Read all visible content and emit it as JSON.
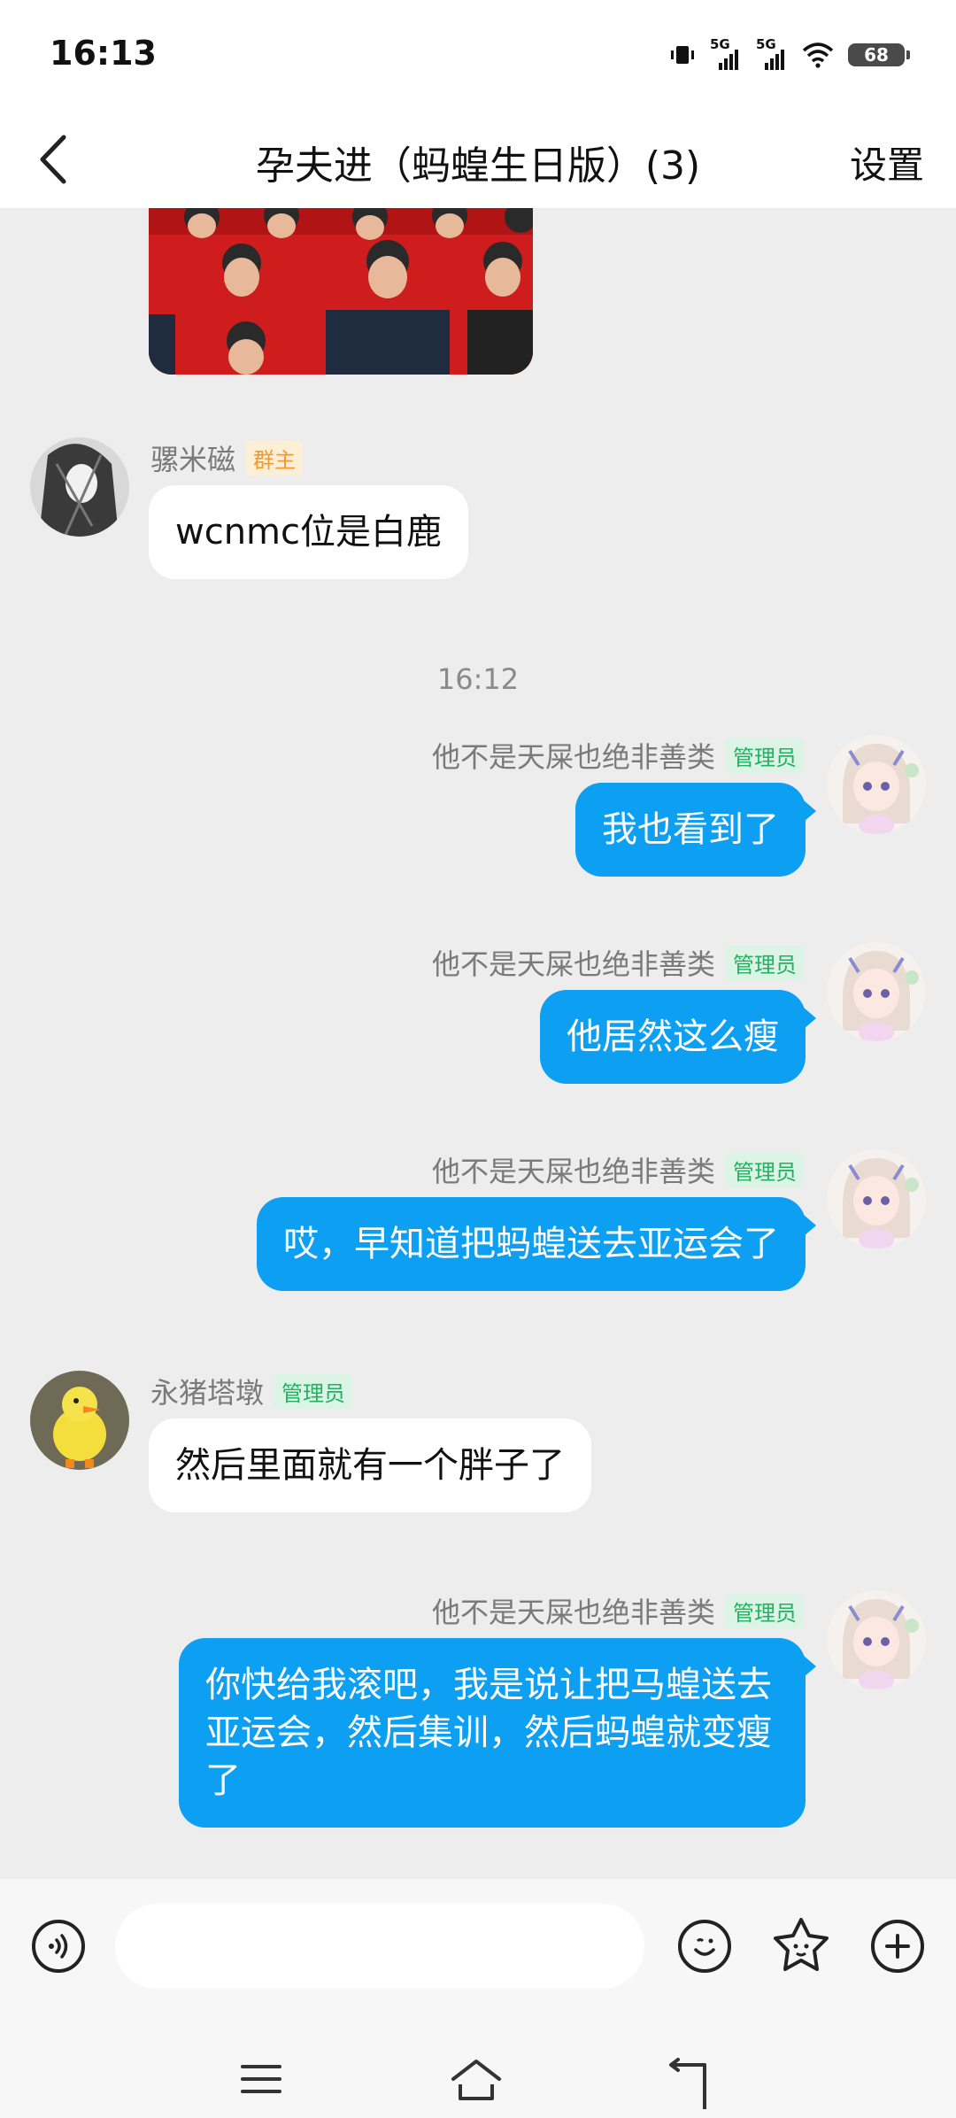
{
  "status_bar": {
    "time": "16:13",
    "signal_1_label": "5G",
    "signal_2_label": "5G",
    "battery_level": "68"
  },
  "header": {
    "title": "孕夫进（蚂蝗生日版）(3)",
    "settings_label": "设置"
  },
  "timestamp": "16:12",
  "messages": [
    {
      "sender": "骡米磁",
      "badge": "群主",
      "text": "wcnmc位是白鹿",
      "side": "left"
    },
    {
      "sender": "他不是天屎也绝非善类",
      "badge": "管理员",
      "text": "我也看到了",
      "side": "right"
    },
    {
      "sender": "他不是天屎也绝非善类",
      "badge": "管理员",
      "text": "他居然这么瘦",
      "side": "right"
    },
    {
      "sender": "他不是天屎也绝非善类",
      "badge": "管理员",
      "text": "哎，早知道把蚂蝗送去亚运会了",
      "side": "right"
    },
    {
      "sender": "永猪塔墩",
      "badge": "管理员",
      "text": "然后里面就有一个胖子了",
      "side": "left"
    },
    {
      "sender": "他不是天屎也绝非善类",
      "badge": "管理员",
      "text": "你快给我滚吧，我是说让把马蝗送去亚运会，然后集训，然后蚂蝗就变瘦了",
      "side": "right"
    }
  ],
  "input": {
    "placeholder": "",
    "value": ""
  },
  "icons": {
    "back": "chevron-left-icon",
    "voice": "voice-icon",
    "emoji": "emoji-icon",
    "sticker": "sticker-icon",
    "plus": "plus-icon",
    "nav_menu": "menu-icon",
    "nav_home": "home-icon",
    "nav_back": "back-icon"
  },
  "colors": {
    "bubble_right": "#0d9ff2",
    "bubble_left": "#ffffff",
    "chat_background": "#ededed",
    "owner_badge": "#f29a2e",
    "admin_badge": "#22b161"
  }
}
